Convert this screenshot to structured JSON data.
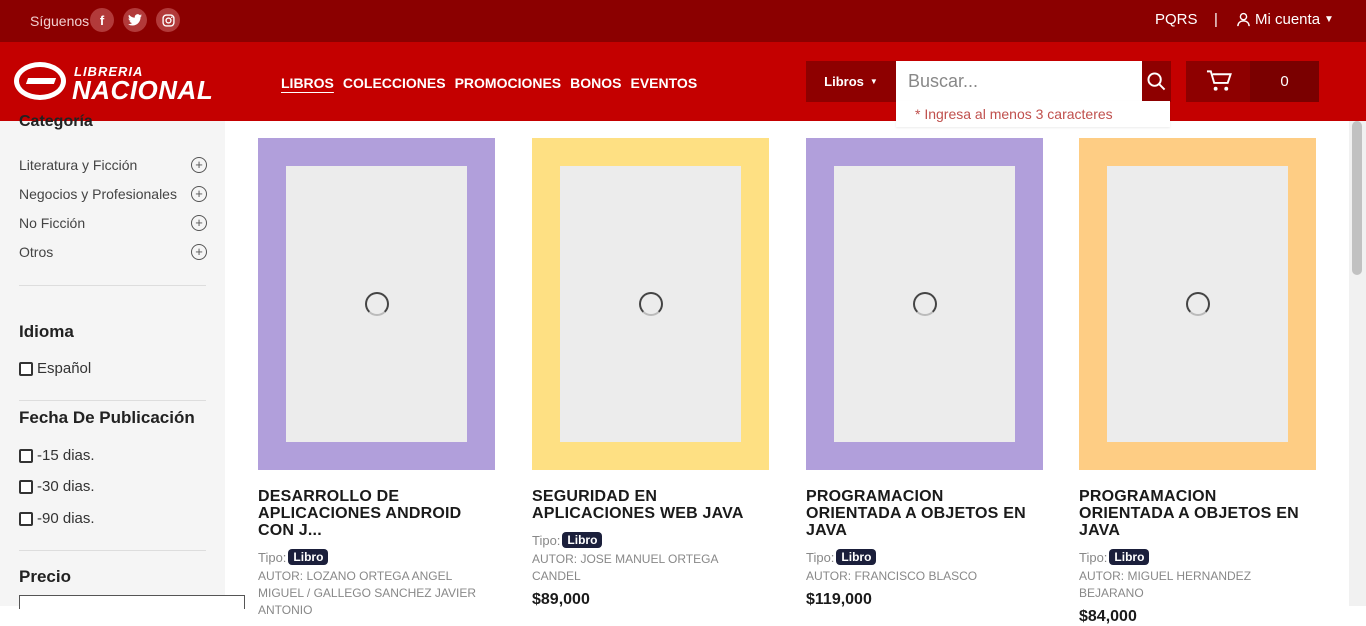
{
  "topbar": {
    "follow_label": "Síguenos",
    "social": [
      {
        "name": "facebook-icon",
        "glyph": "f"
      },
      {
        "name": "twitter-icon",
        "glyph": "t"
      },
      {
        "name": "instagram-icon",
        "glyph": "◎"
      }
    ],
    "pqrs": "PQRS",
    "separator": "|",
    "account": "Mi cuenta"
  },
  "header": {
    "logo_line1": "LIBRERIA",
    "logo_line2": "NACIONAL",
    "nav": [
      "LIBROS",
      "COLECCIONES",
      "PROMOCIONES",
      "BONOS",
      "EVENTOS"
    ],
    "search_category": "Libros",
    "search_placeholder": "Buscar...",
    "search_hint": "* Ingresa al menos 3 caracteres",
    "cart_count": "0"
  },
  "sidebar": {
    "category_title": "Categoría",
    "categories": [
      "Literatura y Ficción",
      "Negocios y Profesionales",
      "No Ficción",
      "Otros"
    ],
    "language_title": "Idioma",
    "languages": [
      "Español"
    ],
    "date_title": "Fecha De Publicación",
    "dates": [
      "-15 dias.",
      "-30 dias.",
      "-90 dias."
    ],
    "price_title": "Precio"
  },
  "products": [
    {
      "title": "DESARROLLO DE APLICACIONES ANDROID CON J...",
      "type_label": "Tipo:",
      "type": "Libro",
      "author": "Autor: LOZANO ORTEGA ANGEL MIGUEL / GALLEGO SANCHEZ JAVIER ANTONIO",
      "price": "",
      "cover_color": "#b19fdb"
    },
    {
      "title": "SEGURIDAD EN APLICACIONES WEB JAVA",
      "type_label": "Tipo:",
      "type": "Libro",
      "author": "Autor: JOSE MANUEL ORTEGA CANDEL",
      "price": "$89,000",
      "cover_color": "#fee083"
    },
    {
      "title": "PROGRAMACION ORIENTADA A OBJETOS EN JAVA",
      "type_label": "Tipo:",
      "type": "Libro",
      "author": "Autor: FRANCISCO BLASCO",
      "price": "$119,000",
      "cover_color": "#b19fdb"
    },
    {
      "title": "PROGRAMACION ORIENTADA A OBJETOS EN JAVA",
      "type_label": "Tipo:",
      "type": "Libro",
      "author": "Autor: MIGUEL HERNANDEZ BEJARANO",
      "price": "$84,000",
      "cover_color": "#fecd84"
    }
  ]
}
